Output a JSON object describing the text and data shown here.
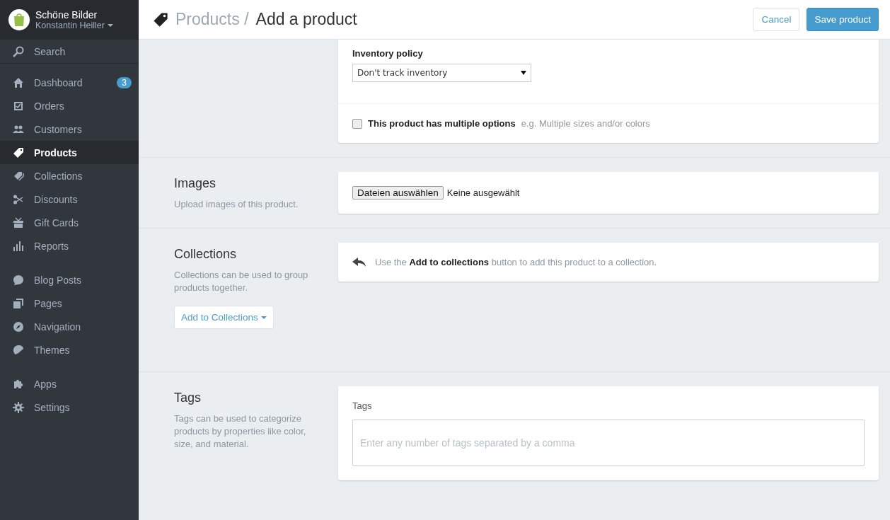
{
  "store": {
    "name": "Schöne Bilder",
    "user": "Konstantin Heiller"
  },
  "sidebar": {
    "search": "Search",
    "groups": [
      [
        {
          "label": "Dashboard",
          "selected": false,
          "badge": "3"
        },
        {
          "label": "Orders",
          "selected": false
        },
        {
          "label": "Customers",
          "selected": false
        },
        {
          "label": "Products",
          "selected": true
        },
        {
          "label": "Collections",
          "selected": false
        },
        {
          "label": "Discounts",
          "selected": false
        },
        {
          "label": "Gift Cards",
          "selected": false
        },
        {
          "label": "Reports",
          "selected": false
        }
      ],
      [
        {
          "label": "Blog Posts",
          "selected": false
        },
        {
          "label": "Pages",
          "selected": false
        },
        {
          "label": "Navigation",
          "selected": false
        },
        {
          "label": "Themes",
          "selected": false
        }
      ],
      [
        {
          "label": "Apps",
          "selected": false
        },
        {
          "label": "Settings",
          "selected": false
        }
      ]
    ]
  },
  "header": {
    "breadcrumb": "Products /",
    "title": "Add a product",
    "cancel": "Cancel",
    "save": "Save product"
  },
  "inventory": {
    "label": "Inventory policy",
    "value": "Don't track inventory",
    "options_label": "This product has multiple options",
    "options_hint": "e.g. Multiple sizes and/or colors",
    "checked": false
  },
  "images": {
    "title": "Images",
    "description": "Upload images of this product.",
    "file_button": "Dateien auswählen",
    "file_status": "Keine ausgewählt"
  },
  "collections": {
    "title": "Collections",
    "description": "Collections can be used to group products together.",
    "button": "Add to Collections",
    "hint": "Use the **Add to collections** button to add this product to a collection."
  },
  "tags": {
    "title": "Tags",
    "description": "Tags can be used to categorize products by properties like color, size, and material.",
    "label": "Tags",
    "placeholder": "Enter any number of tags separated by a comma"
  }
}
